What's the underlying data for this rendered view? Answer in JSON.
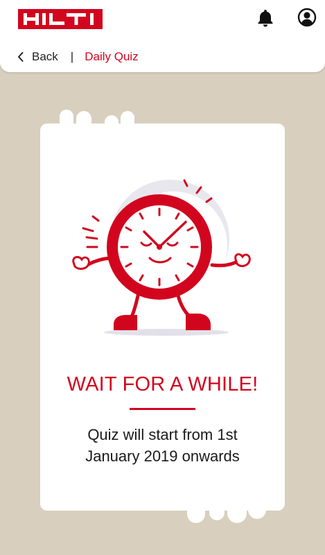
{
  "brand": {
    "logo_text": "HILTI",
    "color": "#d2051e"
  },
  "header": {
    "notification_icon": "bell-icon",
    "profile_icon": "user-circle-icon"
  },
  "nav": {
    "back_label": "Back",
    "separator": "|",
    "current": "Daily Quiz"
  },
  "quiz": {
    "illustration": "smiling-clock-mascot",
    "title": "WAIT FOR A WHILE!",
    "message_line1": "Quiz will start from 1st",
    "message_line2": "January 2019 onwards"
  },
  "colors": {
    "background": "#d8cfbe",
    "card": "#ffffff",
    "accent": "#d2051e"
  }
}
